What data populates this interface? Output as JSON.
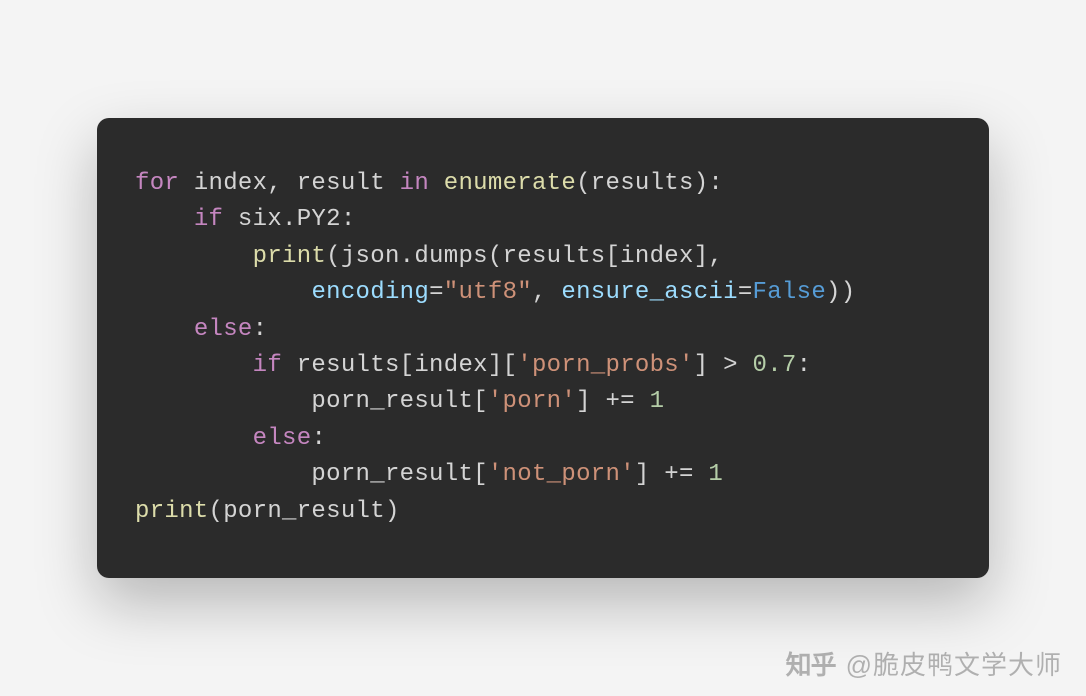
{
  "code": {
    "lines": [
      [
        {
          "cls": "tok-keyword",
          "t": "for"
        },
        {
          "cls": "tok-default",
          "t": " index, result "
        },
        {
          "cls": "tok-keyword",
          "t": "in"
        },
        {
          "cls": "tok-default",
          "t": " "
        },
        {
          "cls": "tok-builtin",
          "t": "enumerate"
        },
        {
          "cls": "tok-punct",
          "t": "(results):"
        }
      ],
      [
        {
          "cls": "tok-default",
          "t": "    "
        },
        {
          "cls": "tok-keyword",
          "t": "if"
        },
        {
          "cls": "tok-default",
          "t": " six.PY2:"
        }
      ],
      [
        {
          "cls": "tok-default",
          "t": "        "
        },
        {
          "cls": "tok-builtin",
          "t": "print"
        },
        {
          "cls": "tok-punct",
          "t": "(json.dumps(results[index],"
        }
      ],
      [
        {
          "cls": "tok-default",
          "t": "            "
        },
        {
          "cls": "tok-identifier",
          "t": "encoding"
        },
        {
          "cls": "tok-punct",
          "t": "="
        },
        {
          "cls": "tok-string",
          "t": "\"utf8\""
        },
        {
          "cls": "tok-punct",
          "t": ", "
        },
        {
          "cls": "tok-identifier",
          "t": "ensure_ascii"
        },
        {
          "cls": "tok-punct",
          "t": "="
        },
        {
          "cls": "tok-constant",
          "t": "False"
        },
        {
          "cls": "tok-punct",
          "t": "))"
        }
      ],
      [
        {
          "cls": "tok-default",
          "t": "    "
        },
        {
          "cls": "tok-keyword",
          "t": "else"
        },
        {
          "cls": "tok-punct",
          "t": ":"
        }
      ],
      [
        {
          "cls": "tok-default",
          "t": "        "
        },
        {
          "cls": "tok-keyword",
          "t": "if"
        },
        {
          "cls": "tok-default",
          "t": " results[index]["
        },
        {
          "cls": "tok-string",
          "t": "'porn_probs'"
        },
        {
          "cls": "tok-default",
          "t": "] > "
        },
        {
          "cls": "tok-number",
          "t": "0.7"
        },
        {
          "cls": "tok-punct",
          "t": ":"
        }
      ],
      [
        {
          "cls": "tok-default",
          "t": "            porn_result["
        },
        {
          "cls": "tok-string",
          "t": "'porn'"
        },
        {
          "cls": "tok-default",
          "t": "] += "
        },
        {
          "cls": "tok-number",
          "t": "1"
        }
      ],
      [
        {
          "cls": "tok-default",
          "t": "        "
        },
        {
          "cls": "tok-keyword",
          "t": "else"
        },
        {
          "cls": "tok-punct",
          "t": ":"
        }
      ],
      [
        {
          "cls": "tok-default",
          "t": "            porn_result["
        },
        {
          "cls": "tok-string",
          "t": "'not_porn'"
        },
        {
          "cls": "tok-default",
          "t": "] += "
        },
        {
          "cls": "tok-number",
          "t": "1"
        }
      ],
      [
        {
          "cls": "tok-builtin",
          "t": "print"
        },
        {
          "cls": "tok-punct",
          "t": "(porn_result)"
        }
      ]
    ]
  },
  "watermark": {
    "logo": "知乎",
    "text": "@脆皮鸭文学大师"
  }
}
